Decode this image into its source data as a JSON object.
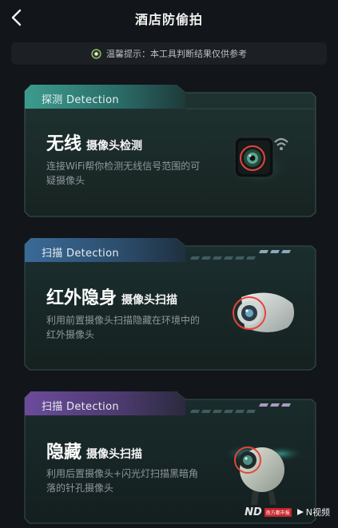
{
  "header": {
    "title": "酒店防偷拍"
  },
  "tip": {
    "text": "温馨提示：本工具判断结果仅供参考"
  },
  "cards": [
    {
      "tab": "探测 Detection",
      "title_main": "无线",
      "title_sub": "摄像头检测",
      "desc": "连接WiFi帮你检测无线信号范围的可疑摄像头",
      "accent": "#3fa595"
    },
    {
      "tab": "扫描 Detection",
      "title_main": "红外隐身",
      "title_sub": "摄像头扫描",
      "desc": "利用前置摄像头扫描隐藏在环境中的红外摄像头",
      "accent": "#3d6f9c"
    },
    {
      "tab": "扫描 Detection",
      "title_main": "隐藏",
      "title_sub": "摄像头扫描",
      "desc": "利用后置摄像头+闪光灯扫描黑暗角落的针孔摄像头",
      "accent": "#6e4e9e"
    }
  ],
  "watermark": {
    "brand": "ND",
    "badge": "南方都市报",
    "video": "N视频"
  },
  "colors": {
    "background": "#121519",
    "tip_bg": "#1c2024",
    "lens_red": "#e5443a"
  }
}
